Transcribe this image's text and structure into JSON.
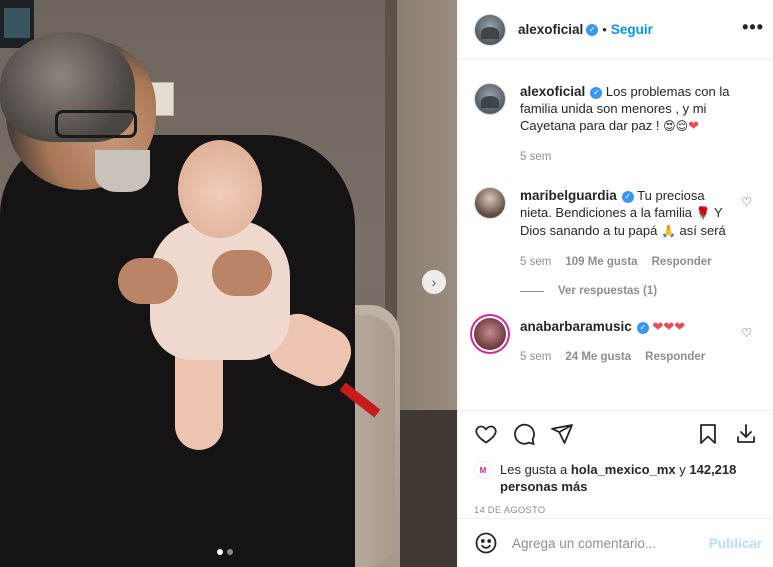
{
  "post": {
    "author": "alexoficial",
    "follow_label": "Seguir",
    "separator": "•",
    "more_glyph": "•••",
    "carousel": {
      "next_glyph": "›",
      "total_slides": 2,
      "current_slide": 1
    }
  },
  "comments": [
    {
      "username": "alexoficial",
      "text": "Los problemas con la familia unida son menores , y mi Cayetana para dar paz !",
      "emojis": [
        "😍",
        "😌"
      ],
      "trailing_heart": "❤",
      "time": "5 sem"
    },
    {
      "username": "maribelguardia",
      "text": "Tu preciosa nieta. Bendiciones a la familia",
      "emoji_rose": "🌹",
      "text2": "Y Dios sanando a tu papá",
      "emoji_pray": "🙏",
      "text3": "así será",
      "time": "5 sem",
      "likes": "109 Me gusta",
      "reply": "Responder",
      "view_replies": "Ver respuestas (1)"
    },
    {
      "username": "anabarbaramusic",
      "text": "❤❤❤",
      "time": "5 sem",
      "likes": "24 Me gusta",
      "reply": "Responder"
    }
  ],
  "likes_summary": {
    "prefix": "Les gusta a",
    "user": "hola_mexico_mx",
    "connector": "y",
    "count": "142,218 personas más",
    "mini_avatar_label": "M"
  },
  "date": "14 DE AGOSTO",
  "composer": {
    "placeholder": "Agrega un comentario...",
    "post_label": "Publicar"
  },
  "icons": {
    "like": "heart-icon",
    "comment": "comment-icon",
    "share": "share-icon",
    "save": "bookmark-icon",
    "download": "download-icon",
    "emoji": "emoji-icon",
    "comment_like": "small-heart-icon"
  },
  "colors": {
    "accent": "#0095f6",
    "verified": "#3897f0",
    "post_disabled": "#b2dffc",
    "muted": "#8e8e8e",
    "heart": "#ed4956"
  }
}
